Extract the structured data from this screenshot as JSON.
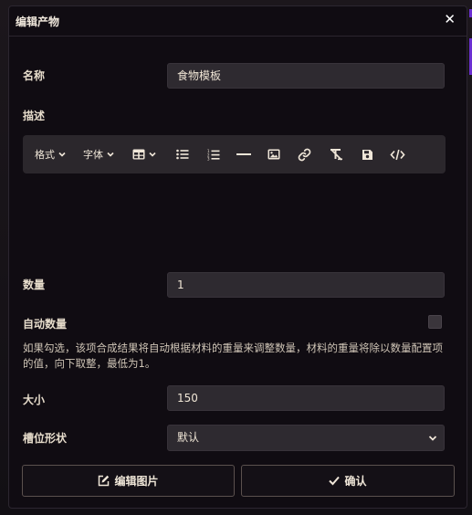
{
  "dialog": {
    "title": "编辑产物",
    "close_glyph": "✕"
  },
  "form": {
    "name_label": "名称",
    "name_value": "食物模板",
    "desc_label": "描述",
    "quantity_label": "数量",
    "quantity_value": "1",
    "auto_quantity_label": "自动数量",
    "auto_quantity_checked": false,
    "auto_quantity_help": "如果勾选，该项合成结果将自动根据材料的重量来调整数量，材料的重量将除以数量配置项的值，向下取整，最低为1。",
    "size_label": "大小",
    "size_value": "150",
    "slot_shape_label": "槽位形状",
    "slot_shape_value": "默认"
  },
  "toolbar": {
    "format_label": "格式",
    "font_label": "字体",
    "icons": [
      "table-icon",
      "bulleted-list-icon",
      "numbered-list-icon",
      "horizontal-rule-icon",
      "image-icon",
      "link-icon",
      "clear-format-icon",
      "save-icon",
      "code-icon"
    ]
  },
  "buttons": {
    "edit_image_label": "编辑图片",
    "confirm_label": "确认"
  },
  "colors": {
    "background": "#100c12",
    "field": "#2e2a30",
    "text": "#e6dccb",
    "accent": "#6b2fd1"
  }
}
